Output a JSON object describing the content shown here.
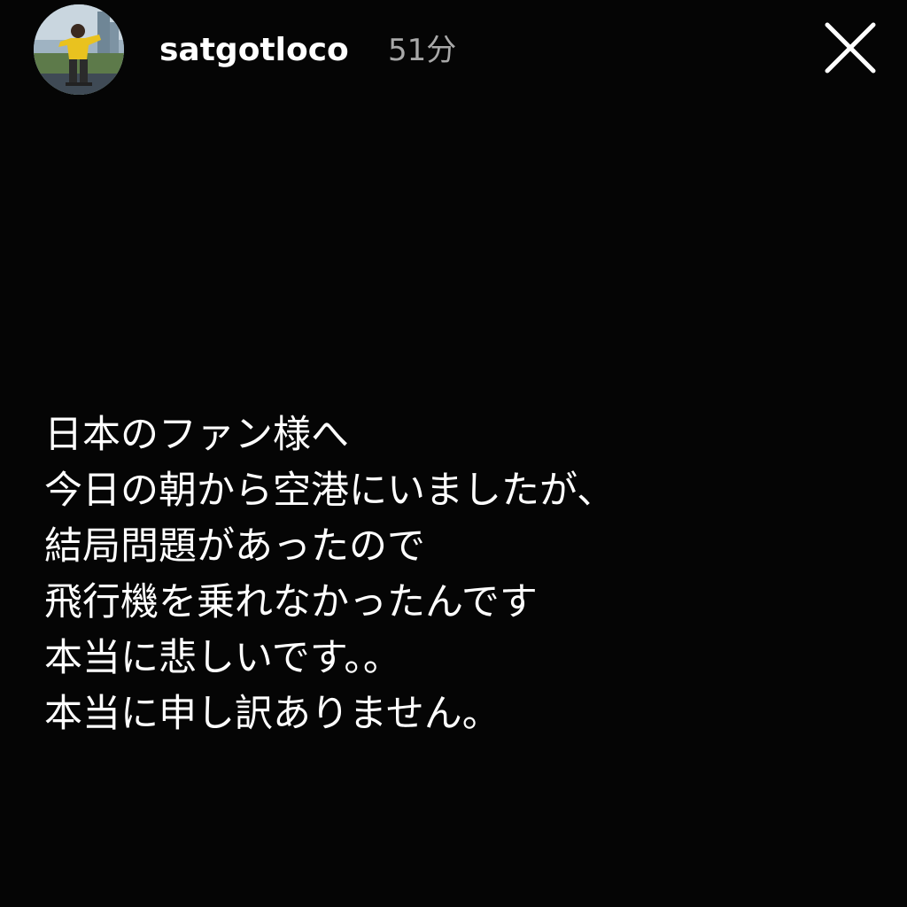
{
  "story": {
    "username": "satgotloco",
    "posted_ago": "51分",
    "avatar_icon": "profile-photo-person-yellow-hoodie",
    "close_icon": "close-x-icon",
    "text_color": "#ffffff",
    "background_color": "#050505",
    "timestamp_color": "#a8a8a8",
    "message_lines": [
      "日本のファン様へ",
      "今日の朝から空港にいましたが、",
      "結局問題があったので",
      "飛行機を乗れなかったんです",
      "本当に悲しいです。。",
      "本当に申し訳ありません。"
    ]
  }
}
